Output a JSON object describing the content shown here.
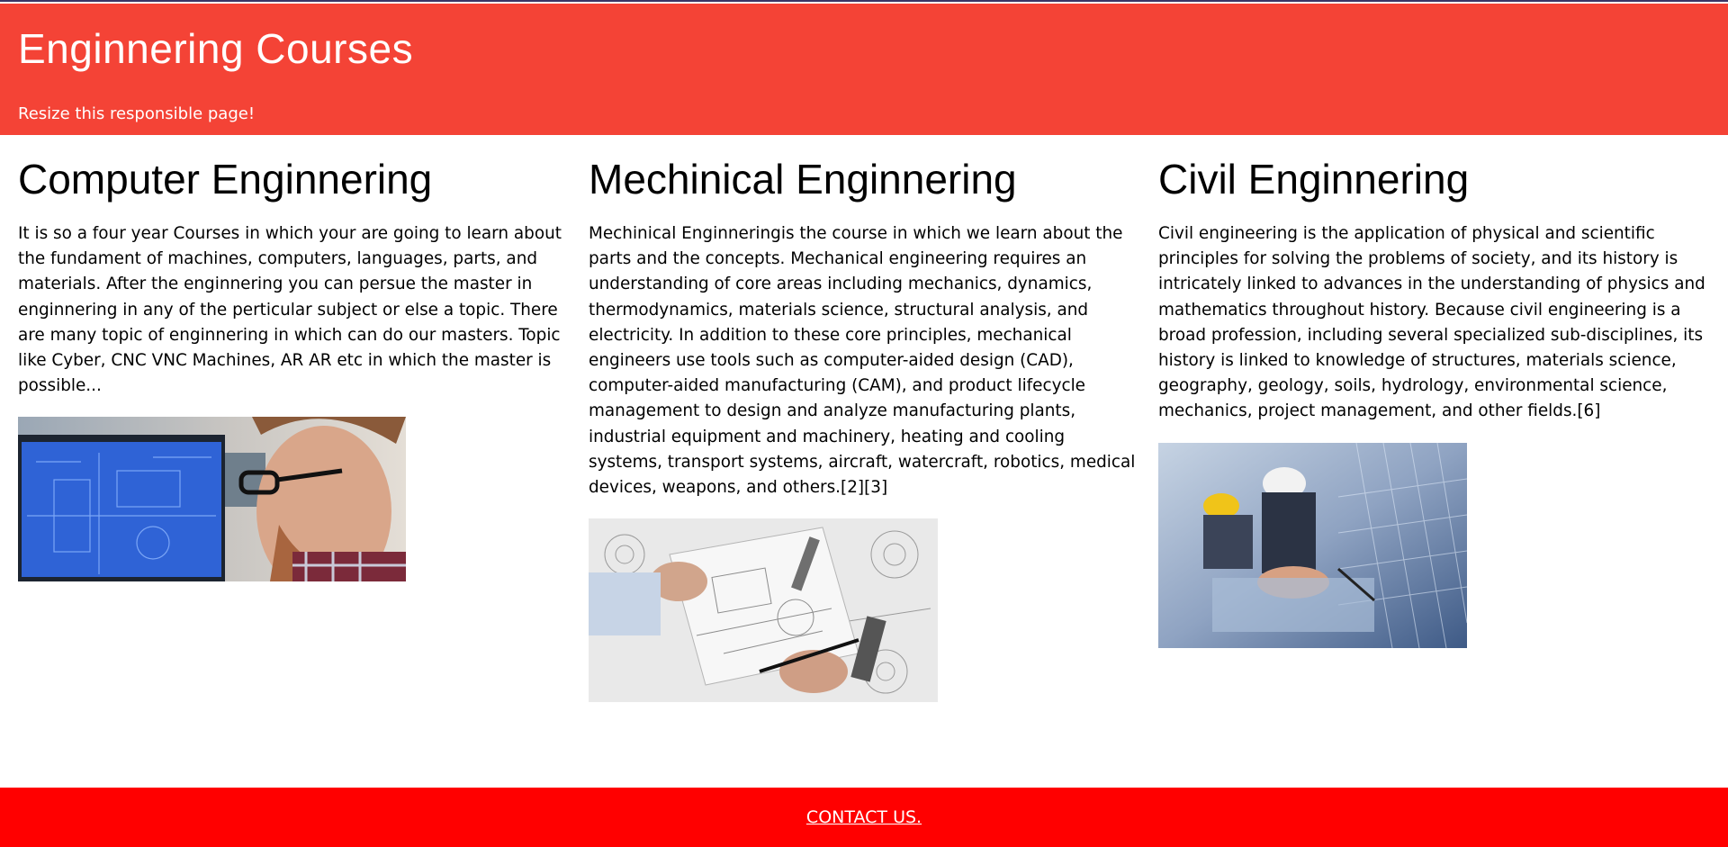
{
  "header": {
    "title": "Enginnering Courses",
    "subtitle": "Resize this responsible page!"
  },
  "columns": [
    {
      "heading": "Computer Enginnering",
      "text": "It is so a four year Courses in which your are going to learn about the fundament of machines, computers, languages, parts, and materials. After the enginnering you can persue the master in enginnering in any of the perticular subject or else a topic. There are many topic of enginnering in which can do our masters. Topic like Cyber, CNC VNC Machines, AR AR etc in which the master is possible..."
    },
    {
      "heading": "Mechinical Enginnering",
      "text": "Mechinical Enginneringis the course in which we learn about the parts and the concepts. Mechanical engineering requires an understanding of core areas including mechanics, dynamics, thermodynamics, materials science, structural analysis, and electricity. In addition to these core principles, mechanical engineers use tools such as computer-aided design (CAD), computer-aided manufacturing (CAM), and product lifecycle management to design and analyze manufacturing plants, industrial equipment and machinery, heating and cooling systems, transport systems, aircraft, watercraft, robotics, medical devices, weapons, and others.[2][3]"
    },
    {
      "heading": "Civil Enginnering",
      "text": "Civil engineering is the application of physical and scientific principles for solving the problems of society, and its history is intricately linked to advances in the understanding of physics and mathematics throughout history. Because civil engineering is a broad profession, including several specialized sub-disciplines, its history is linked to knowledge of structures, materials science, geography, geology, soils, hydrology, environmental science, mechanics, project management, and other fields.[6]"
    }
  ],
  "footer": {
    "link": "CONTACT US."
  },
  "colors": {
    "header_bg": "#f44336",
    "footer_bg": "#ff0000"
  }
}
